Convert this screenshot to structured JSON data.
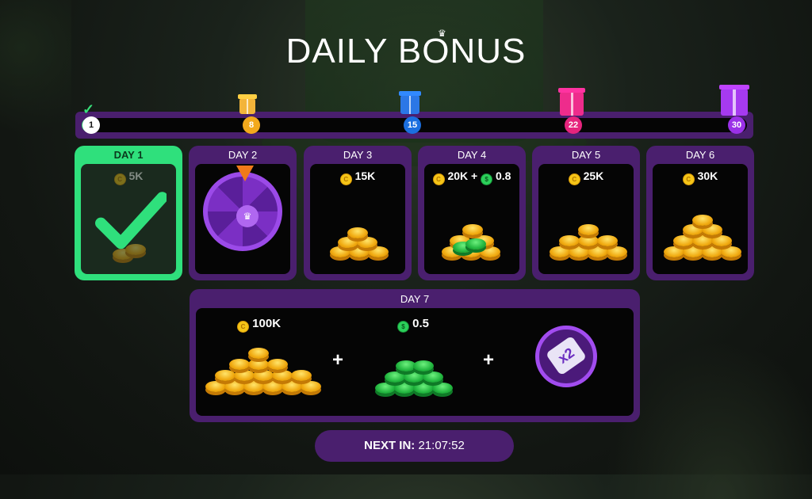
{
  "title": "DAILY BONUS",
  "progress": {
    "current_day": 1,
    "milestones": [
      "1",
      "8",
      "15",
      "22",
      "30"
    ]
  },
  "days": [
    {
      "label": "DAY 1",
      "reward": "5K",
      "claimed": true
    },
    {
      "label": "DAY 2",
      "reward": ""
    },
    {
      "label": "DAY 3",
      "reward": "15K"
    },
    {
      "label": "DAY 4",
      "reward_coins": "20K",
      "reward_plus": "+",
      "reward_cash": "0.8"
    },
    {
      "label": "DAY 5",
      "reward": "25K"
    },
    {
      "label": "DAY 6",
      "reward": "30K"
    }
  ],
  "day7": {
    "label": "DAY 7",
    "coins": "100K",
    "cash": "0.5",
    "plus": "+",
    "multiplier": "x2"
  },
  "next": {
    "label": "NEXT IN:",
    "time": "21:07:52"
  },
  "icons": {
    "coin": "C",
    "cash": "$",
    "crown": "♛"
  },
  "colors": {
    "panel": "#4a1f6e",
    "claimed": "#2fe07c",
    "coin": "#f5c518",
    "cash": "#2bd05a"
  }
}
